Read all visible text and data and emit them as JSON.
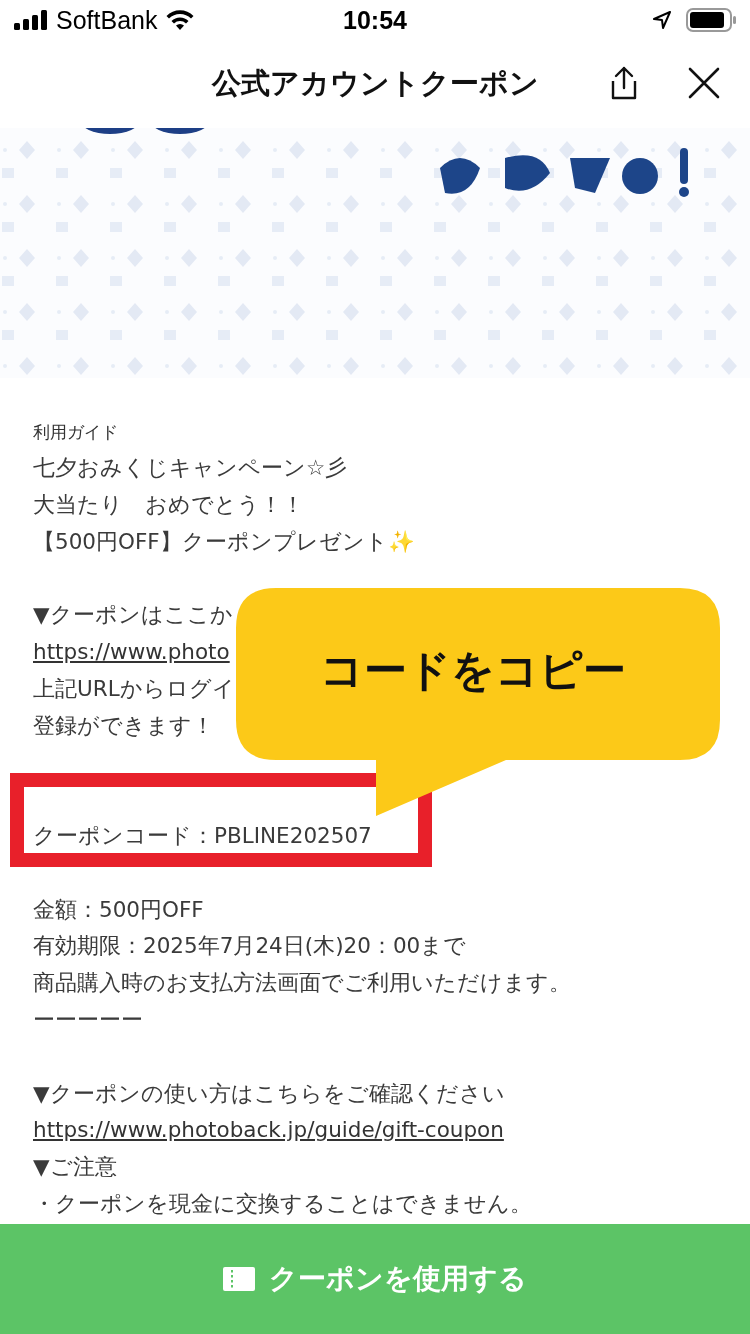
{
  "status_bar": {
    "carrier": "SoftBank",
    "time": "10:54"
  },
  "header": {
    "title": "公式アカウントクーポン"
  },
  "guide": {
    "label": "利用ガイド",
    "lines": [
      {
        "kind": "text",
        "text": "七夕おみくじキャンペーン☆彡"
      },
      {
        "kind": "text",
        "text": "大当たり　おめでとう！！"
      },
      {
        "kind": "text",
        "text": "【500円OFF】クーポンプレゼント✨"
      },
      {
        "kind": "blank"
      },
      {
        "kind": "text",
        "text": "▼クーポンはここか"
      },
      {
        "kind": "link",
        "text": "https://www.photo"
      },
      {
        "kind": "text",
        "text": "上記URLからログイ"
      },
      {
        "kind": "text",
        "text": "登録ができます！"
      },
      {
        "kind": "blank"
      },
      {
        "kind": "blank"
      },
      {
        "kind": "text",
        "text": "クーポンコード：PBLINE202507"
      },
      {
        "kind": "blank"
      },
      {
        "kind": "text",
        "text": "金額：500円OFF"
      },
      {
        "kind": "text",
        "text": "有効期限：2025年7月24日(木)20：00まで"
      },
      {
        "kind": "text",
        "text": "商品購入時のお支払方法画面でご利用いただけます。"
      },
      {
        "kind": "text",
        "text": "ーーーーー"
      },
      {
        "kind": "blank"
      },
      {
        "kind": "text",
        "text": "▼クーポンの使い方はこちらをご確認ください"
      },
      {
        "kind": "link",
        "text": "https://www.photoback.jp/guide/gift-coupon"
      },
      {
        "kind": "text",
        "text": "▼ご注意"
      },
      {
        "kind": "text",
        "text": "・クーポンを現金に交換することはできません。"
      }
    ]
  },
  "callout": {
    "text": "コードをコピー"
  },
  "use_button": {
    "label": "クーポンを使用する"
  }
}
